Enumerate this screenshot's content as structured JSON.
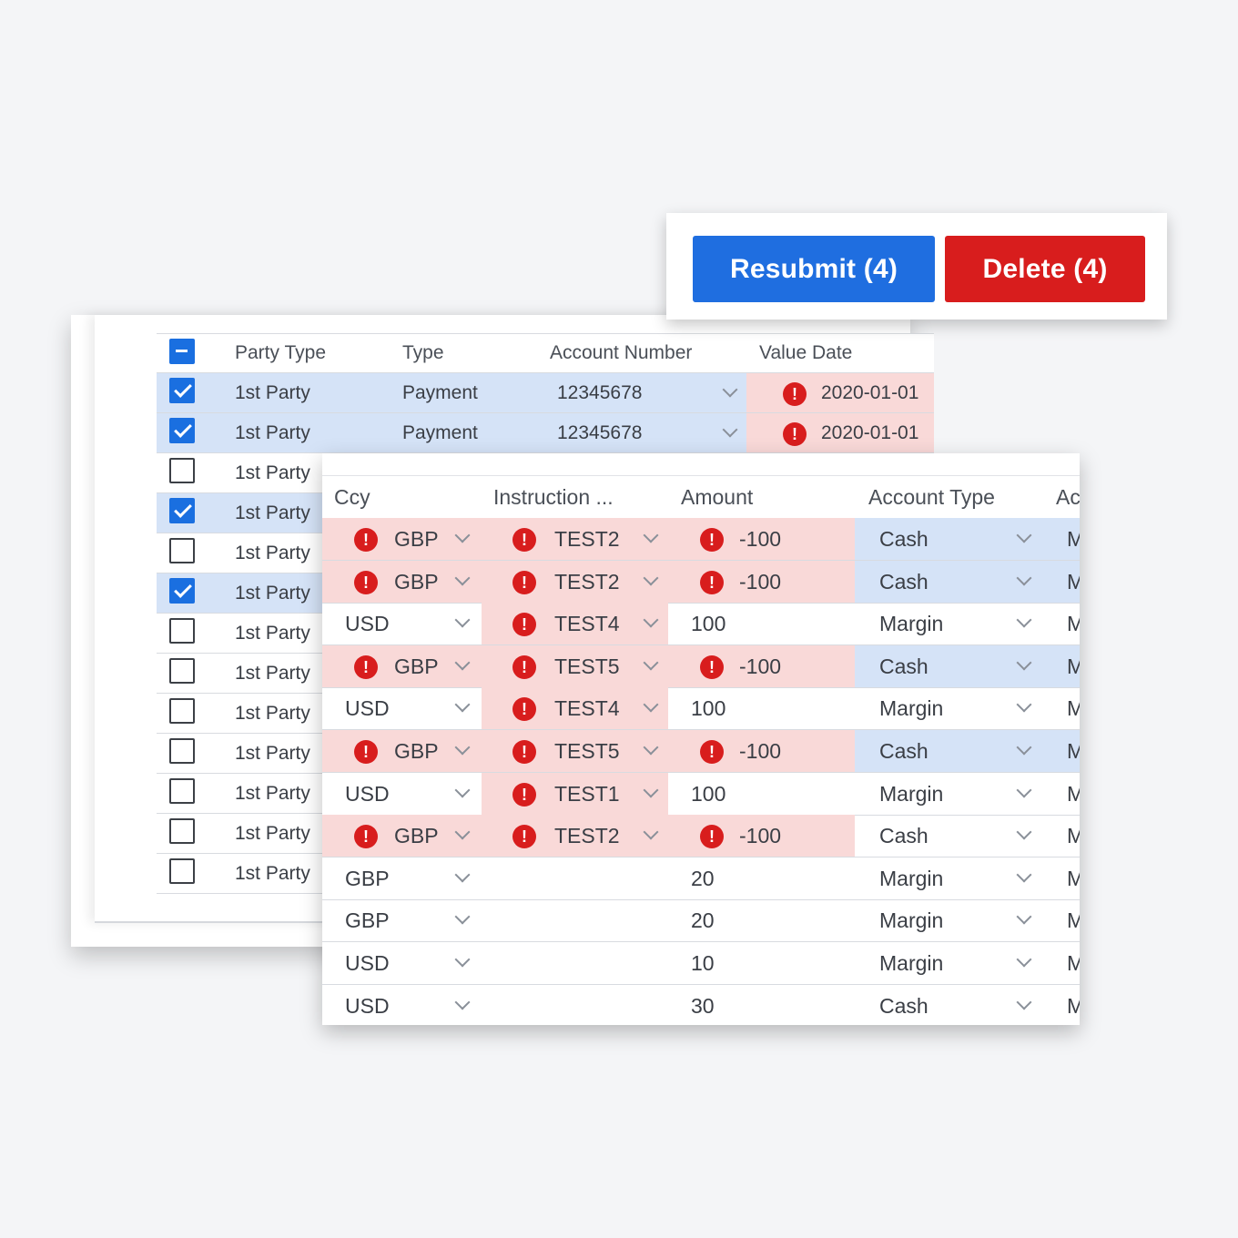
{
  "actions": {
    "resubmit_label": "Resubmit (4)",
    "delete_label": "Delete (4)",
    "resubmit_color": "#1f6ee0",
    "delete_color": "#d81d1d"
  },
  "party_table": {
    "headers": {
      "party_type": "Party Type",
      "type": "Type",
      "account_number": "Account Number",
      "value_date": "Value Date"
    },
    "header_checkbox_state": "indeterminate",
    "rows": [
      {
        "checked": true,
        "party_type": "1st Party",
        "type": "Payment",
        "account_number": "12345678",
        "value_date": "2020-01-01",
        "value_date_error": true
      },
      {
        "checked": true,
        "party_type": "1st Party",
        "type": "Payment",
        "account_number": "12345678",
        "value_date": "2020-01-01",
        "value_date_error": true
      },
      {
        "checked": false,
        "party_type": "1st Party"
      },
      {
        "checked": true,
        "party_type": "1st Party"
      },
      {
        "checked": false,
        "party_type": "1st Party"
      },
      {
        "checked": true,
        "party_type": "1st Party"
      },
      {
        "checked": false,
        "party_type": "1st Party"
      },
      {
        "checked": false,
        "party_type": "1st Party"
      },
      {
        "checked": false,
        "party_type": "1st Party"
      },
      {
        "checked": false,
        "party_type": "1st Party"
      },
      {
        "checked": false,
        "party_type": "1st Party"
      },
      {
        "checked": false,
        "party_type": "1st Party"
      },
      {
        "checked": false,
        "party_type": "1st Party"
      }
    ]
  },
  "detail_table": {
    "headers": {
      "ccy": "Ccy",
      "instruction": "Instruction ...",
      "amount": "Amount",
      "account_type": "Account Type",
      "next": "Ac"
    },
    "rows": [
      {
        "ccy": "GBP",
        "ccy_error": true,
        "instruction": "TEST2",
        "instruction_error": true,
        "amount": "-100",
        "amount_error": true,
        "account_type": "Cash",
        "selected": true,
        "next": "M"
      },
      {
        "ccy": "GBP",
        "ccy_error": true,
        "instruction": "TEST2",
        "instruction_error": true,
        "amount": "-100",
        "amount_error": true,
        "account_type": "Cash",
        "selected": true,
        "next": "M"
      },
      {
        "ccy": "USD",
        "ccy_error": false,
        "instruction": "TEST4",
        "instruction_error": true,
        "amount": "100",
        "amount_error": false,
        "account_type": "Margin",
        "selected": false,
        "next": "M"
      },
      {
        "ccy": "GBP",
        "ccy_error": true,
        "instruction": "TEST5",
        "instruction_error": true,
        "amount": "-100",
        "amount_error": true,
        "account_type": "Cash",
        "selected": true,
        "next": "M"
      },
      {
        "ccy": "USD",
        "ccy_error": false,
        "instruction": "TEST4",
        "instruction_error": true,
        "amount": "100",
        "amount_error": false,
        "account_type": "Margin",
        "selected": false,
        "next": "M"
      },
      {
        "ccy": "GBP",
        "ccy_error": true,
        "instruction": "TEST5",
        "instruction_error": true,
        "amount": "-100",
        "amount_error": true,
        "account_type": "Cash",
        "selected": true,
        "next": "M"
      },
      {
        "ccy": "USD",
        "ccy_error": false,
        "instruction": "TEST1",
        "instruction_error": true,
        "amount": "100",
        "amount_error": false,
        "account_type": "Margin",
        "selected": false,
        "next": "M"
      },
      {
        "ccy": "GBP",
        "ccy_error": true,
        "instruction": "TEST2",
        "instruction_error": true,
        "amount": "-100",
        "amount_error": true,
        "account_type": "Cash",
        "selected": false,
        "next": "M"
      },
      {
        "ccy": "GBP",
        "ccy_error": false,
        "instruction": "",
        "instruction_error": false,
        "amount": "20",
        "amount_error": false,
        "account_type": "Margin",
        "selected": false,
        "next": "M"
      },
      {
        "ccy": "GBP",
        "ccy_error": false,
        "instruction": "",
        "instruction_error": false,
        "amount": "20",
        "amount_error": false,
        "account_type": "Margin",
        "selected": false,
        "next": "M"
      },
      {
        "ccy": "USD",
        "ccy_error": false,
        "instruction": "",
        "instruction_error": false,
        "amount": "10",
        "amount_error": false,
        "account_type": "Margin",
        "selected": false,
        "next": "M"
      },
      {
        "ccy": "USD",
        "ccy_error": false,
        "instruction": "",
        "instruction_error": false,
        "amount": "30",
        "amount_error": false,
        "account_type": "Cash",
        "selected": false,
        "next": "M"
      }
    ]
  },
  "icons": {
    "error": "exclamation-circle-icon",
    "dropdown": "chevron-down-icon"
  },
  "colors": {
    "error_bg": "#f9d9d8",
    "selected_bg": "#d5e3f7",
    "error_icon": "#d81d1d",
    "checkbox_on": "#1a6fe0"
  },
  "glyphs": {
    "error": "!"
  }
}
